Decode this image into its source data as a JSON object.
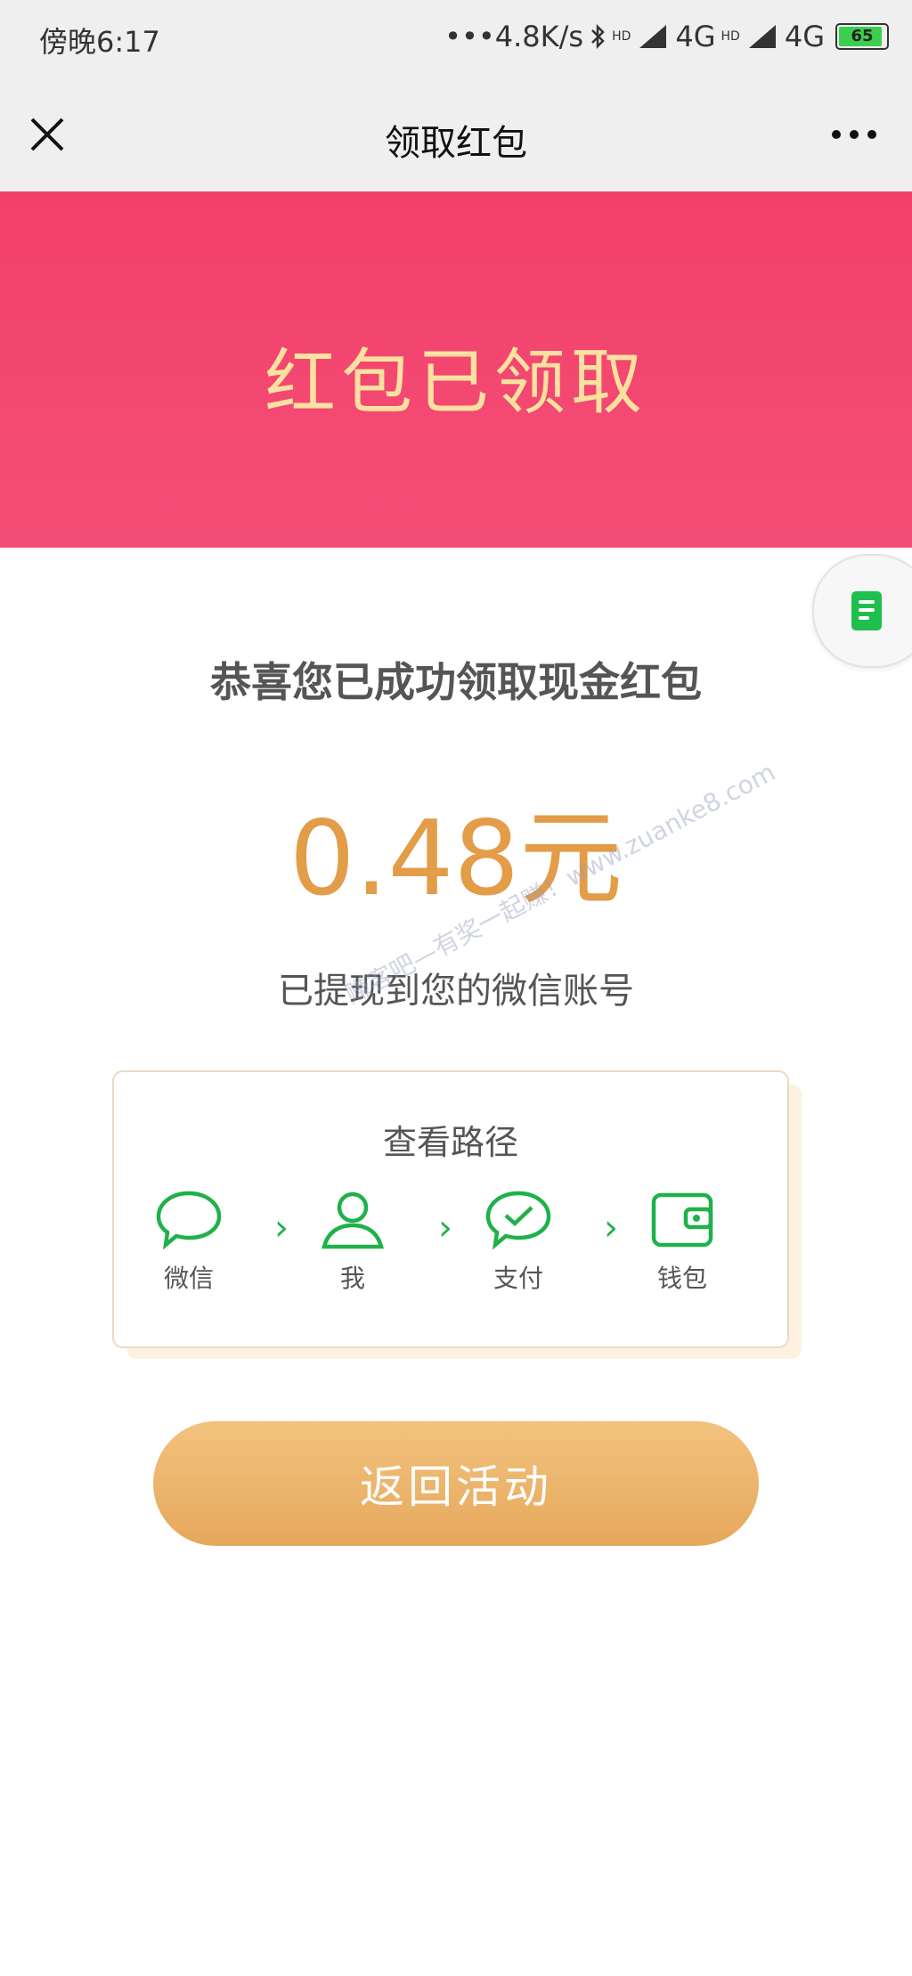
{
  "status_bar": {
    "time": "傍晚6:17",
    "network": "•••4.8K/s",
    "hd1": "HD",
    "net1": "4G",
    "hd2": "HD",
    "net2": "4G",
    "battery": "65"
  },
  "nav": {
    "title": "领取红包",
    "close_icon": "close-icon",
    "more_icon": "more-icon"
  },
  "banner": {
    "title": "红包已领取"
  },
  "content": {
    "congrats": "恭喜您已成功领取现金红包",
    "amount": "0.48元",
    "withdrawn": "已提现到您的微信账号",
    "watermark": "赚客吧—有奖一起赚！www.zuanke8.com"
  },
  "path_card": {
    "title": "查看路径",
    "steps": [
      {
        "label": "微信",
        "icon": "chat-bubble-icon"
      },
      {
        "label": "我",
        "icon": "person-icon"
      },
      {
        "label": "支付",
        "icon": "check-bubble-icon"
      },
      {
        "label": "钱包",
        "icon": "wallet-icon"
      }
    ]
  },
  "actions": {
    "return_label": "返回活动"
  },
  "colors": {
    "banner": "#f2406a",
    "banner_title": "#fbe1a0",
    "amount": "#e39c48",
    "icon_green": "#1fb14a",
    "button": "#eab36a"
  }
}
